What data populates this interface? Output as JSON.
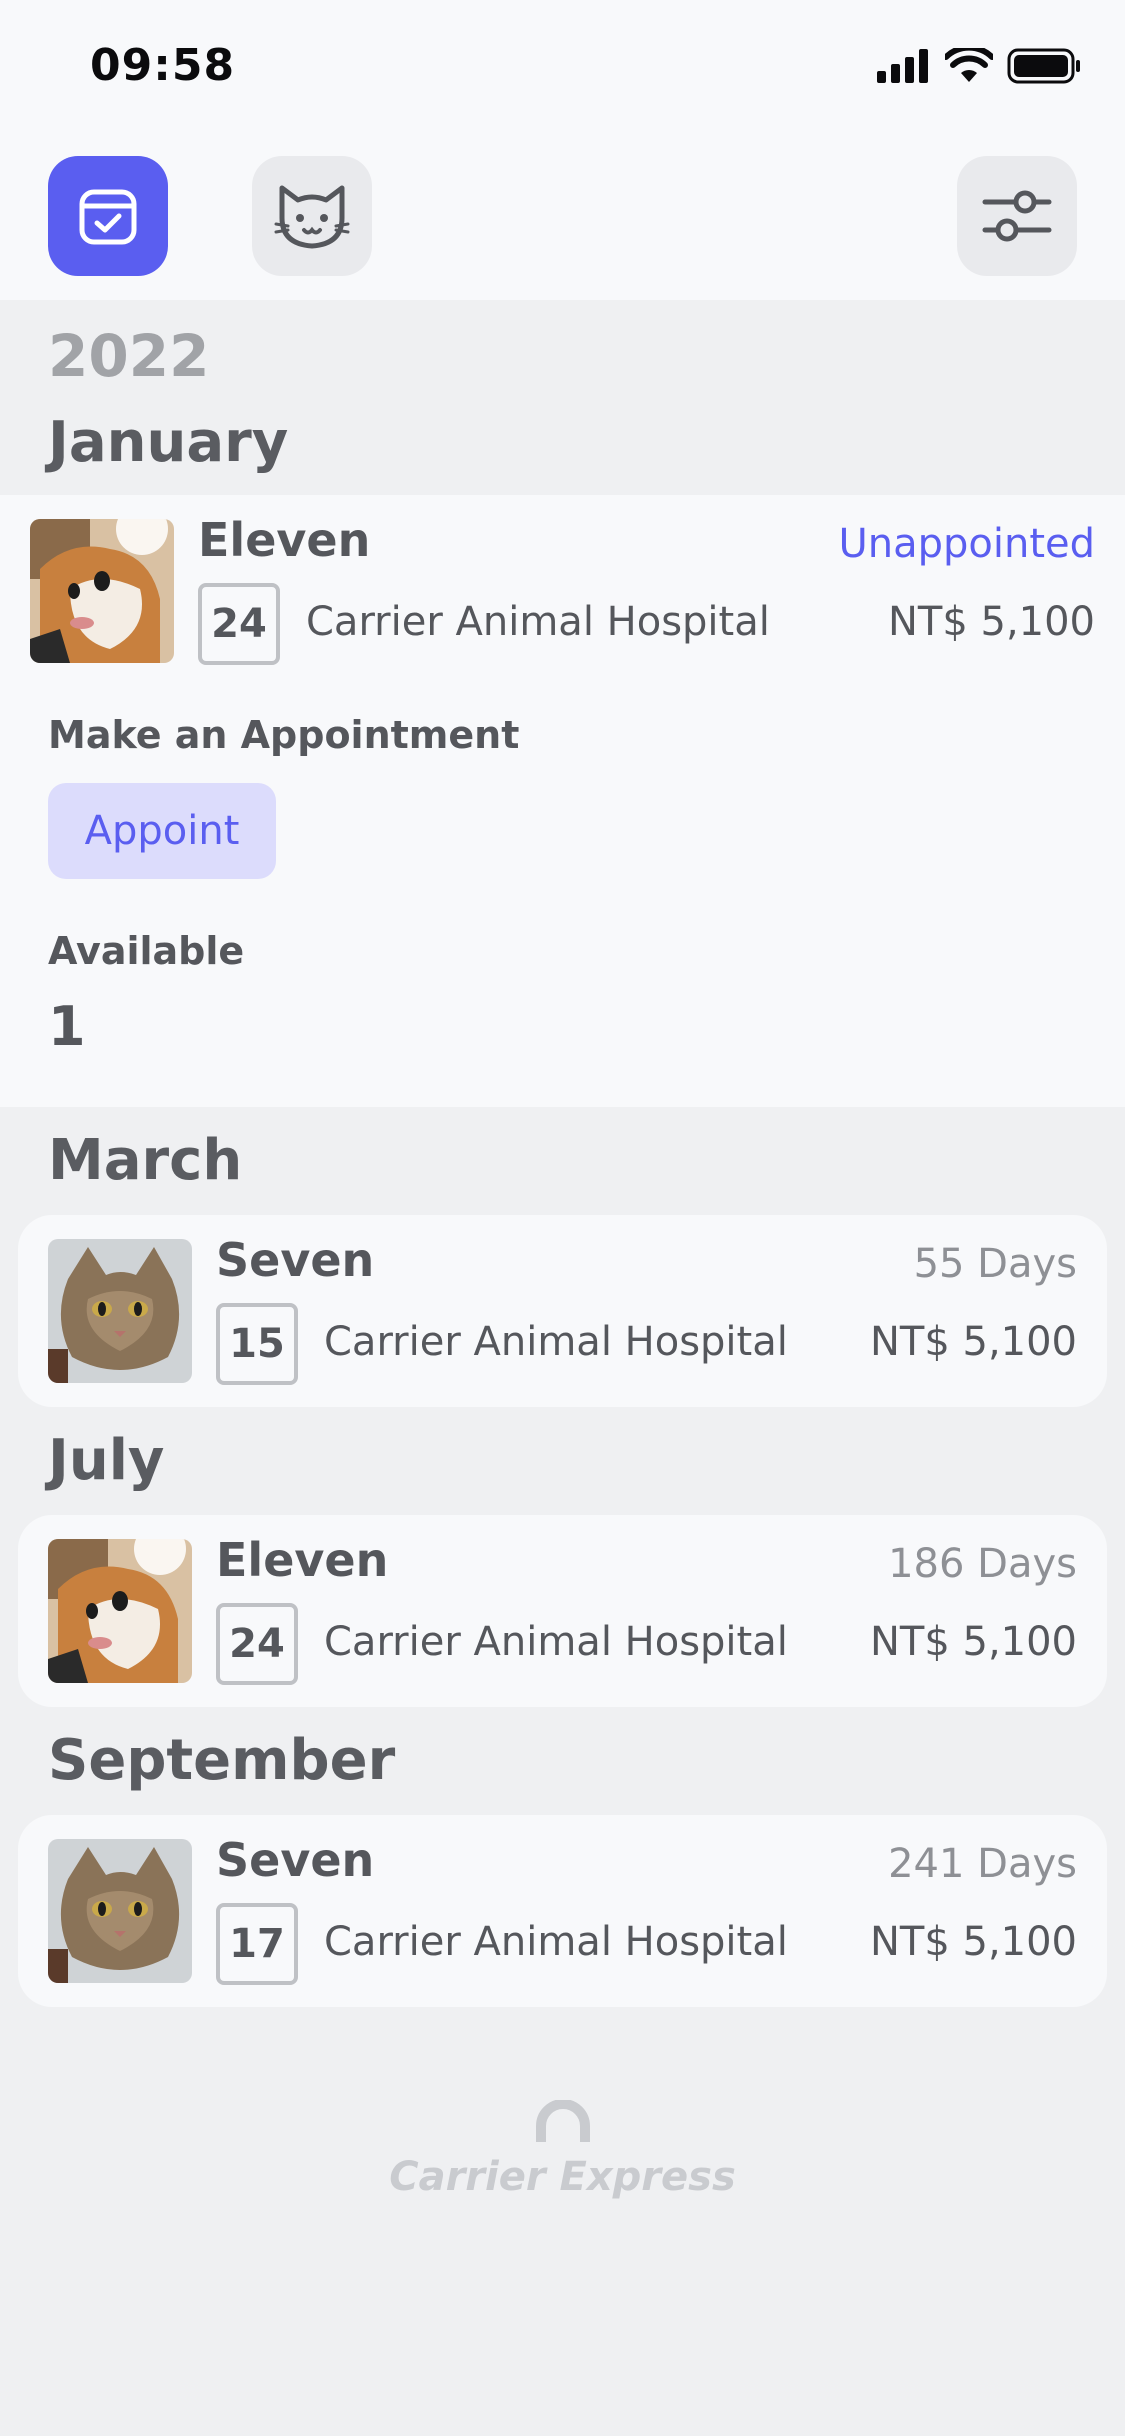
{
  "status_bar": {
    "time": "09:58"
  },
  "toolbar": {
    "icons": [
      "calendar-check-icon",
      "cat-icon",
      "sliders-icon"
    ],
    "accent_color": "#5a5ef0"
  },
  "year": "2022",
  "months": {
    "january": "January",
    "march": "March",
    "july": "July",
    "september": "September"
  },
  "entries": [
    {
      "pet": "Eleven",
      "day": "24",
      "hospital": "Carrier Animal Hospital",
      "status": "Unappointed",
      "price": "NT$ 5,100"
    },
    {
      "pet": "Seven",
      "day": "15",
      "hospital": "Carrier Animal Hospital",
      "status": "55 Days",
      "price": "NT$ 5,100"
    },
    {
      "pet": "Eleven",
      "day": "24",
      "hospital": "Carrier Animal Hospital",
      "status": "186 Days",
      "price": "NT$ 5,100"
    },
    {
      "pet": "Seven",
      "day": "17",
      "hospital": "Carrier Animal Hospital",
      "status": "241 Days",
      "price": "NT$ 5,100"
    }
  ],
  "appointment": {
    "heading": "Make an Appointment",
    "button_label": "Appoint",
    "available_label": "Available",
    "available_count": "1"
  },
  "footer": {
    "brand": "Carrier Express"
  }
}
